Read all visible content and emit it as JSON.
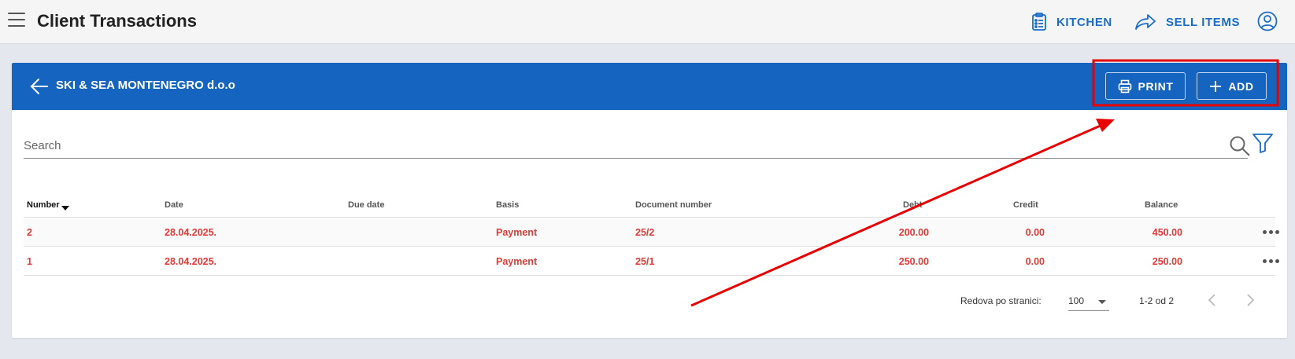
{
  "header": {
    "title": "Client Transactions",
    "nav": [
      {
        "label": "KITCHEN",
        "icon": "clipboard-list-icon"
      },
      {
        "label": "SELL ITEMS",
        "icon": "share-arrow-icon"
      }
    ],
    "user_icon": "account-circle-icon"
  },
  "client": {
    "name": "SKI & SEA MONTENEGRO d.o.o",
    "print_label": "PRINT",
    "add_label": "ADD"
  },
  "search": {
    "placeholder": "Search"
  },
  "table": {
    "columns": [
      "Number",
      "Date",
      "Due date",
      "Basis",
      "Document number",
      "Debt",
      "Credit",
      "Balance"
    ],
    "sorted_column": "Number",
    "rows": [
      {
        "number": "2",
        "date": "28.04.2025.",
        "due_date": "",
        "basis": "Payment",
        "document_number": "25/2",
        "debt": "200.00",
        "credit": "0.00",
        "balance": "450.00"
      },
      {
        "number": "1",
        "date": "28.04.2025.",
        "due_date": "",
        "basis": "Payment",
        "document_number": "25/1",
        "debt": "250.00",
        "credit": "0.00",
        "balance": "250.00"
      }
    ]
  },
  "pagination": {
    "rows_per_page_label": "Redova po stranici:",
    "rows_per_page": "100",
    "range": "1-2 od 2"
  },
  "colors": {
    "header_blue": "#1565c0",
    "accent": "#1a6cc8",
    "row_text": "#e53935",
    "annotation": "#e60000"
  }
}
